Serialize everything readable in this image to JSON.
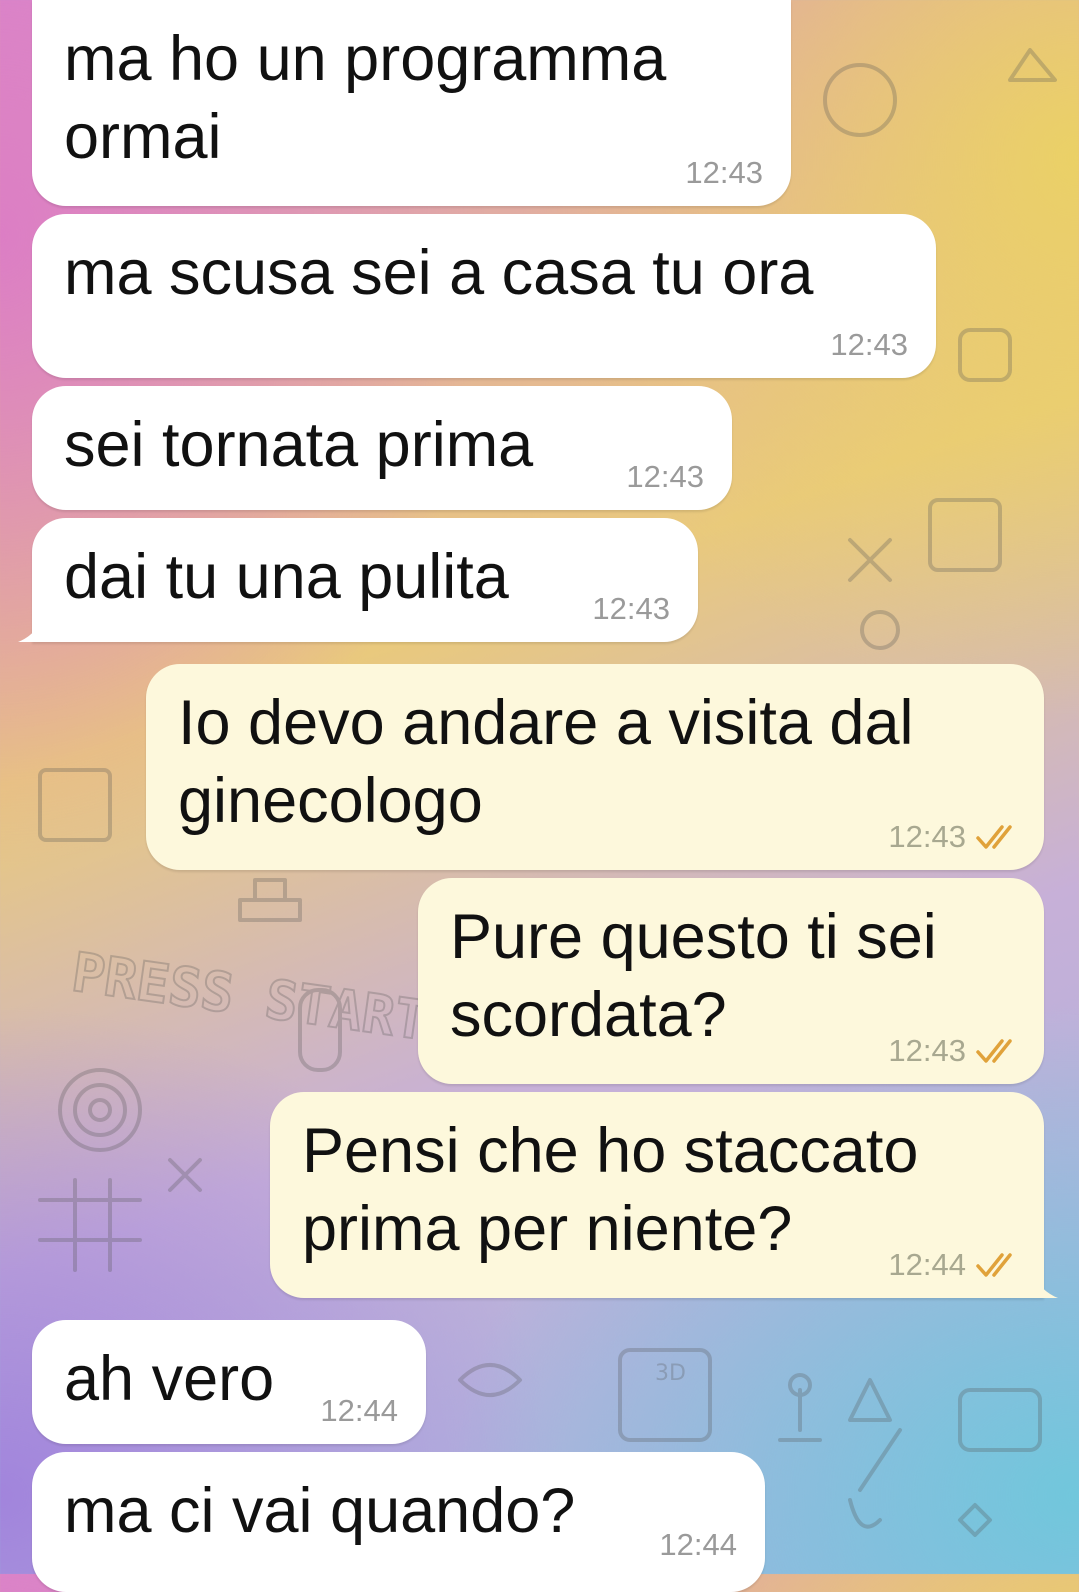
{
  "colors": {
    "incoming_bubble": "#ffffff",
    "outgoing_bubble": "#fdf8dc",
    "read_ticks": "#e0a23a",
    "timestamp": "#9a9a9a"
  },
  "wallpaper": {
    "press_start_text": "PRESS START",
    "console_label": "3D"
  },
  "messages": [
    {
      "direction": "incoming",
      "text": "ma ho un programma\normai",
      "time": "12:43"
    },
    {
      "direction": "incoming",
      "text": "ma scusa sei a casa tu ora",
      "time": "12:43"
    },
    {
      "direction": "incoming",
      "text": "sei tornata prima",
      "time": "12:43"
    },
    {
      "direction": "incoming",
      "text": "dai tu una pulita",
      "time": "12:43"
    },
    {
      "direction": "outgoing",
      "text": "Io devo andare a visita dal\nginecologo",
      "time": "12:43",
      "status": "read"
    },
    {
      "direction": "outgoing",
      "text": "Pure questo ti sei\nscordata?",
      "time": "12:43",
      "status": "read"
    },
    {
      "direction": "outgoing",
      "text": "Pensi che ho staccato\nprima per niente?",
      "time": "12:44",
      "status": "read"
    },
    {
      "direction": "incoming",
      "text": "ah vero",
      "time": "12:44"
    },
    {
      "direction": "incoming",
      "text": "ma ci vai quando?",
      "time": "12:44"
    }
  ]
}
